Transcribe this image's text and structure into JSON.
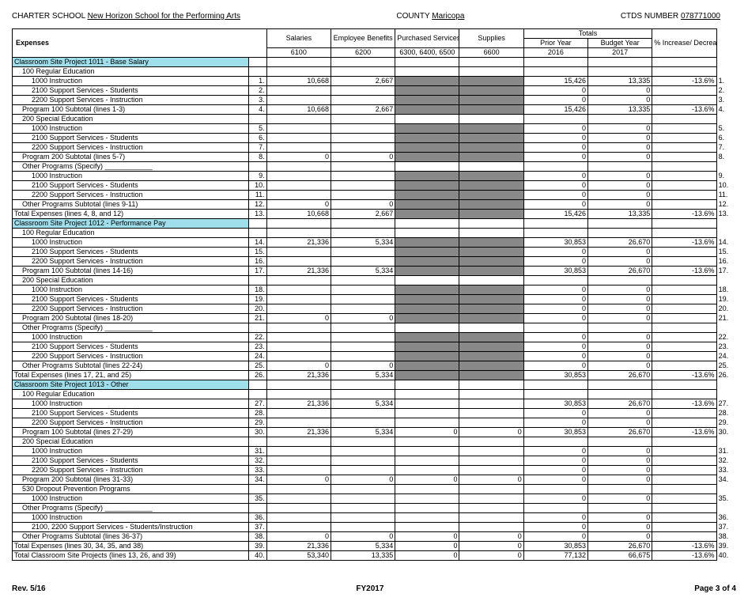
{
  "header": {
    "charter_label": "CHARTER SCHOOL",
    "charter_value": "New Horizon School for the Performing Arts",
    "county_label": "COUNTY",
    "county_value": "Maricopa",
    "ctds_label": "CTDS NUMBER",
    "ctds_value": "078771000"
  },
  "columns": {
    "expenses": "Expenses",
    "salaries": "Salaries",
    "salaries_sub": "6100",
    "benefits": "Employee Benefits",
    "benefits_sub": "6200",
    "purchased": "Purchased Services",
    "purchased_sub": "6300, 6400, 6500",
    "supplies": "Supplies",
    "supplies_sub": "6600",
    "totals": "Totals",
    "prior": "Prior Year",
    "prior_sub": "2016",
    "budget": "Budget Year",
    "budget_sub": "2017",
    "pct": "% Increase/ Decrease"
  },
  "rows": [
    {
      "d": "Classroom Site Project 1011 - Base Salary",
      "hi": true
    },
    {
      "d": "100 Regular Education",
      "cls": "indent1"
    },
    {
      "d": "1000 Instruction",
      "cls": "indent2",
      "ln": "1.",
      "sal": "10,668",
      "ben": "2,667",
      "pur": "s",
      "sup": "s",
      "pri": "15,426",
      "bud": "13,335",
      "pct": "-13.6%",
      "ln2": "1."
    },
    {
      "d": "2100 Support Services - Students",
      "cls": "indent2",
      "ln": "2.",
      "pur": "s",
      "sup": "s",
      "pri": "0",
      "bud": "0",
      "ln2": "2."
    },
    {
      "d": "2200 Support Services - Instruction",
      "cls": "indent2",
      "ln": "3.",
      "pur": "s",
      "sup": "s",
      "pri": "0",
      "bud": "0",
      "ln2": "3."
    },
    {
      "d": "Program 100 Subtotal (lines 1-3)",
      "cls": "indent1",
      "ln": "4.",
      "sal": "10,668",
      "ben": "2,667",
      "pur": "s",
      "sup": "s",
      "pri": "15,426",
      "bud": "13,335",
      "pct": "-13.6%",
      "ln2": "4."
    },
    {
      "d": "200 Special Education",
      "cls": "indent1"
    },
    {
      "d": "1000 Instruction",
      "cls": "indent2",
      "ln": "5.",
      "pur": "s",
      "sup": "s",
      "pri": "0",
      "bud": "0",
      "ln2": "5."
    },
    {
      "d": "2100 Support Services - Students",
      "cls": "indent2",
      "ln": "6.",
      "pur": "s",
      "sup": "s",
      "pri": "0",
      "bud": "0",
      "ln2": "6."
    },
    {
      "d": "2200 Support Services - Instruction",
      "cls": "indent2",
      "ln": "7.",
      "pur": "s",
      "sup": "s",
      "pri": "0",
      "bud": "0",
      "ln2": "7."
    },
    {
      "d": "Program 200 Subtotal (lines 5-7)",
      "cls": "indent1",
      "ln": "8.",
      "sal": "0",
      "ben": "0",
      "pur": "s",
      "sup": "s",
      "pri": "0",
      "bud": "0",
      "ln2": "8."
    },
    {
      "d": "Other Programs (Specify) ____________",
      "cls": "indent1"
    },
    {
      "d": "1000 Instruction",
      "cls": "indent2",
      "ln": "9.",
      "pur": "s",
      "sup": "s",
      "pri": "0",
      "bud": "0",
      "ln2": "9."
    },
    {
      "d": "2100 Support Services - Students",
      "cls": "indent2",
      "ln": "10.",
      "pur": "s",
      "sup": "s",
      "pri": "0",
      "bud": "0",
      "ln2": "10."
    },
    {
      "d": "2200 Support Services - Instruction",
      "cls": "indent2",
      "ln": "11.",
      "pur": "s",
      "sup": "s",
      "pri": "0",
      "bud": "0",
      "ln2": "11."
    },
    {
      "d": "Other Programs Subtotal (lines 9-11)",
      "cls": "indent1",
      "ln": "12.",
      "sal": "0",
      "ben": "0",
      "pur": "s",
      "sup": "s",
      "pri": "0",
      "bud": "0",
      "ln2": "12."
    },
    {
      "d": "Total Expenses (lines 4, 8, and 12)",
      "ln": "13.",
      "sal": "10,668",
      "ben": "2,667",
      "pur": "s",
      "sup": "s",
      "pri": "15,426",
      "bud": "13,335",
      "pct": "-13.6%",
      "ln2": "13."
    },
    {
      "d": "Classroom Site Project 1012 - Performance Pay",
      "hi": true
    },
    {
      "d": "100 Regular Education",
      "cls": "indent1"
    },
    {
      "d": "1000 Instruction",
      "cls": "indent2",
      "ln": "14.",
      "sal": "21,336",
      "ben": "5,334",
      "pur": "s",
      "sup": "s",
      "pri": "30,853",
      "bud": "26,670",
      "pct": "-13.6%",
      "ln2": "14."
    },
    {
      "d": "2100 Support Services - Students",
      "cls": "indent2",
      "ln": "15.",
      "pur": "s",
      "sup": "s",
      "pri": "0",
      "bud": "0",
      "ln2": "15."
    },
    {
      "d": "2200 Support Services - Instruction",
      "cls": "indent2",
      "ln": "16.",
      "pur": "s",
      "sup": "s",
      "pri": "0",
      "bud": "0",
      "ln2": "16."
    },
    {
      "d": "Program 100 Subtotal (lines 14-16)",
      "cls": "indent1",
      "ln": "17.",
      "sal": "21,336",
      "ben": "5,334",
      "pur": "s",
      "sup": "s",
      "pri": "30,853",
      "bud": "26,670",
      "pct": "-13.6%",
      "ln2": "17."
    },
    {
      "d": "200 Special Education",
      "cls": "indent1"
    },
    {
      "d": "1000 Instruction",
      "cls": "indent2",
      "ln": "18.",
      "pur": "s",
      "sup": "s",
      "pri": "0",
      "bud": "0",
      "ln2": "18."
    },
    {
      "d": "2100 Support Services - Students",
      "cls": "indent2",
      "ln": "19.",
      "pur": "s",
      "sup": "s",
      "pri": "0",
      "bud": "0",
      "ln2": "19."
    },
    {
      "d": "2200 Support Services - Instruction",
      "cls": "indent2",
      "ln": "20.",
      "pur": "s",
      "sup": "s",
      "pri": "0",
      "bud": "0",
      "ln2": "20."
    },
    {
      "d": "Program 200 Subtotal (lines 18-20)",
      "cls": "indent1",
      "ln": "21.",
      "sal": "0",
      "ben": "0",
      "pur": "s",
      "sup": "s",
      "pri": "0",
      "bud": "0",
      "ln2": "21."
    },
    {
      "d": "Other Programs (Specify) ____________",
      "cls": "indent1"
    },
    {
      "d": "1000 Instruction",
      "cls": "indent2",
      "ln": "22.",
      "pur": "s",
      "sup": "s",
      "pri": "0",
      "bud": "0",
      "ln2": "22."
    },
    {
      "d": "2100 Support Services - Students",
      "cls": "indent2",
      "ln": "23.",
      "pur": "s",
      "sup": "s",
      "pri": "0",
      "bud": "0",
      "ln2": "23."
    },
    {
      "d": "2200 Support Services - Instruction",
      "cls": "indent2",
      "ln": "24.",
      "pur": "s",
      "sup": "s",
      "pri": "0",
      "bud": "0",
      "ln2": "24."
    },
    {
      "d": "Other Programs Subtotal (lines 22-24)",
      "cls": "indent1",
      "ln": "25.",
      "sal": "0",
      "ben": "0",
      "pur": "s",
      "sup": "s",
      "pri": "0",
      "bud": "0",
      "ln2": "25."
    },
    {
      "d": "Total Expenses (lines 17, 21, and 25)",
      "ln": "26.",
      "sal": "21,336",
      "ben": "5,334",
      "pur": "s",
      "sup": "s",
      "pri": "30,853",
      "bud": "26,670",
      "pct": "-13.6%",
      "ln2": "26."
    },
    {
      "d": "Classroom Site Project 1013 - Other",
      "hi": true
    },
    {
      "d": "100 Regular Education",
      "cls": "indent1"
    },
    {
      "d": "1000 Instruction",
      "cls": "indent2",
      "ln": "27.",
      "sal": "21,336",
      "ben": "5,334",
      "pri": "30,853",
      "bud": "26,670",
      "pct": "-13.6%",
      "ln2": "27."
    },
    {
      "d": "2100 Support Services - Students",
      "cls": "indent2",
      "ln": "28.",
      "pri": "0",
      "bud": "0",
      "ln2": "28."
    },
    {
      "d": "2200 Support Services - Instruction",
      "cls": "indent2",
      "ln": "29.",
      "pri": "0",
      "bud": "0",
      "ln2": "29."
    },
    {
      "d": "Program 100 Subtotal (lines 27-29)",
      "cls": "indent1",
      "ln": "30.",
      "sal": "21,336",
      "ben": "5,334",
      "pur": "0",
      "sup": "0",
      "pri": "30,853",
      "bud": "26,670",
      "pct": "-13.6%",
      "ln2": "30."
    },
    {
      "d": "200 Special Education",
      "cls": "indent1"
    },
    {
      "d": "1000 Instruction",
      "cls": "indent2",
      "ln": "31.",
      "pri": "0",
      "bud": "0",
      "ln2": "31."
    },
    {
      "d": "2100 Support Services - Students",
      "cls": "indent2",
      "ln": "32.",
      "pri": "0",
      "bud": "0",
      "ln2": "32."
    },
    {
      "d": "2200 Support Services - Instruction",
      "cls": "indent2",
      "ln": "33.",
      "pri": "0",
      "bud": "0",
      "ln2": "33."
    },
    {
      "d": "Program 200 Subtotal (lines 31-33)",
      "cls": "indent1",
      "ln": "34.",
      "sal": "0",
      "ben": "0",
      "pur": "0",
      "sup": "0",
      "pri": "0",
      "bud": "0",
      "ln2": "34."
    },
    {
      "d": "530 Dropout Prevention Programs",
      "cls": "indent1"
    },
    {
      "d": "1000 Instruction",
      "cls": "indent2",
      "ln": "35.",
      "pri": "0",
      "bud": "0",
      "ln2": "35."
    },
    {
      "d": "Other Programs (Specify) ____________",
      "cls": "indent1"
    },
    {
      "d": "1000 Instruction",
      "cls": "indent2",
      "ln": "36.",
      "pri": "0",
      "bud": "0",
      "ln2": "36."
    },
    {
      "d": "2100, 2200 Support Services - Students/Instruction",
      "cls": "indent2",
      "ln": "37.",
      "pri": "0",
      "bud": "0",
      "ln2": "37."
    },
    {
      "d": "Other Programs Subtotal (lines 36-37)",
      "cls": "indent1",
      "ln": "38.",
      "sal": "0",
      "ben": "0",
      "pur": "0",
      "sup": "0",
      "pri": "0",
      "bud": "0",
      "ln2": "38."
    },
    {
      "d": "Total Expenses (lines 30, 34, 35, and 38)",
      "ln": "39.",
      "sal": "21,336",
      "ben": "5,334",
      "pur": "0",
      "sup": "0",
      "pri": "30,853",
      "bud": "26,670",
      "pct": "-13.6%",
      "ln2": "39."
    },
    {
      "d": "Total Classroom Site Projects (lines 13, 26, and 39)",
      "ln": "40.",
      "sal": "53,340",
      "ben": "13,335",
      "pur": "0",
      "sup": "0",
      "pri": "77,132",
      "bud": "66,675",
      "pct": "-13.6%",
      "ln2": "40."
    }
  ],
  "footer": {
    "rev": "Rev. 5/16",
    "fy": "FY2017",
    "page": "Page 3 of 4"
  }
}
